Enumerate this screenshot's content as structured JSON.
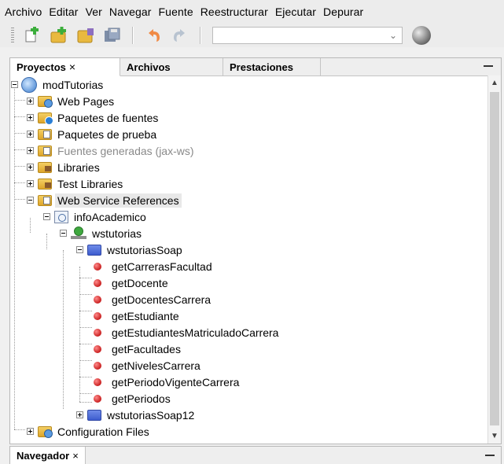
{
  "menubar": [
    "Archivo",
    "Editar",
    "Ver",
    "Navegar",
    "Fuente",
    "Reestructurar",
    "Ejecutar",
    "Depurar"
  ],
  "toolbar": {
    "icons": [
      "new-file-icon",
      "new-project-icon",
      "open-project-icon",
      "save-all-icon",
      "undo-icon",
      "redo-icon"
    ],
    "config_value": ""
  },
  "projects_panel": {
    "tabs": [
      {
        "label": "Proyectos",
        "close": "×"
      },
      {
        "label": "Archivos"
      },
      {
        "label": "Prestaciones"
      }
    ],
    "tree": [
      {
        "label": "modTutorias",
        "icon": "project-icon"
      },
      {
        "label": "Web Pages",
        "icon": "web-folder-icon"
      },
      {
        "label": "Paquetes de fuentes",
        "icon": "source-folder-icon"
      },
      {
        "label": "Paquetes de prueba",
        "icon": "test-folder-icon"
      },
      {
        "label": "Fuentes generadas (jax-ws)",
        "icon": "generated-folder-icon"
      },
      {
        "label": "Libraries",
        "icon": "library-folder-icon"
      },
      {
        "label": "Test Libraries",
        "icon": "test-library-folder-icon"
      },
      {
        "label": "Web Service References",
        "icon": "ws-references-folder-icon"
      },
      {
        "label": "infoAcademico",
        "icon": "ws-reference-icon"
      },
      {
        "label": "wstutorias",
        "icon": "service-icon"
      },
      {
        "label": "wstutoriasSoap",
        "icon": "port-folder-icon"
      },
      {
        "label": "getCarrerasFacultad",
        "icon": "operation-icon"
      },
      {
        "label": "getDocente",
        "icon": "operation-icon"
      },
      {
        "label": "getDocentesCarrera",
        "icon": "operation-icon"
      },
      {
        "label": "getEstudiante",
        "icon": "operation-icon"
      },
      {
        "label": "getEstudiantesMatriculadoCarrera",
        "icon": "operation-icon"
      },
      {
        "label": "getFacultades",
        "icon": "operation-icon"
      },
      {
        "label": "getNivelesCarrera",
        "icon": "operation-icon"
      },
      {
        "label": "getPeriodoVigenteCarrera",
        "icon": "operation-icon"
      },
      {
        "label": "getPeriodos",
        "icon": "operation-icon"
      },
      {
        "label": "wstutoriasSoap12",
        "icon": "port-folder-icon"
      },
      {
        "label": "Configuration Files",
        "icon": "config-folder-icon"
      }
    ]
  },
  "navigator_panel": {
    "tab_label": "Navegador",
    "close": "×"
  },
  "colors": {
    "folder": "#e7b43b",
    "operation": "#d42a2a",
    "selection": "#e8e8e8",
    "border": "#b8b8b8"
  }
}
